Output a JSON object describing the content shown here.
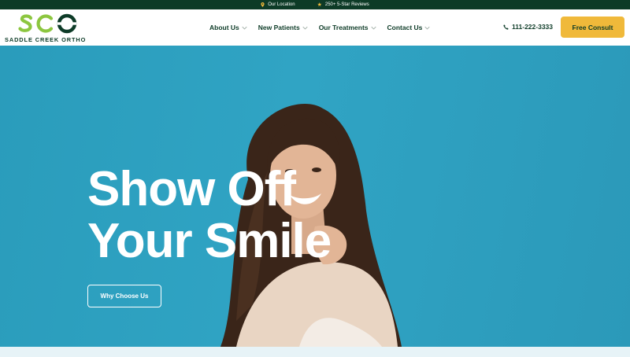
{
  "topbar": {
    "location_label": "Our Location",
    "location_icon": "map-pin-icon",
    "reviews_label": "250+ 5-Star Reviews",
    "reviews_icon": "star-icon"
  },
  "header": {
    "logo_letters": "SCO",
    "logo_name": "SADDLE CREEK ORTHO",
    "nav": [
      {
        "label": "About Us",
        "icon": "chevron-down-icon"
      },
      {
        "label": "New Patients",
        "icon": "chevron-down-icon"
      },
      {
        "label": "Our Treatments",
        "icon": "chevron-down-icon"
      },
      {
        "label": "Contact Us",
        "icon": "chevron-down-icon"
      }
    ],
    "phone": "111-222-3333",
    "phone_icon": "phone-icon",
    "cta_label": "Free Consult"
  },
  "hero": {
    "title_line1": "Show Off",
    "title_line2": "Your Smile",
    "button_label": "Why Choose Us"
  },
  "colors": {
    "brand_dark_green": "#0d3b27",
    "brand_light_green": "#8cc63f",
    "accent_yellow": "#f0b93a",
    "hero_blue": "#2fa3c3"
  }
}
